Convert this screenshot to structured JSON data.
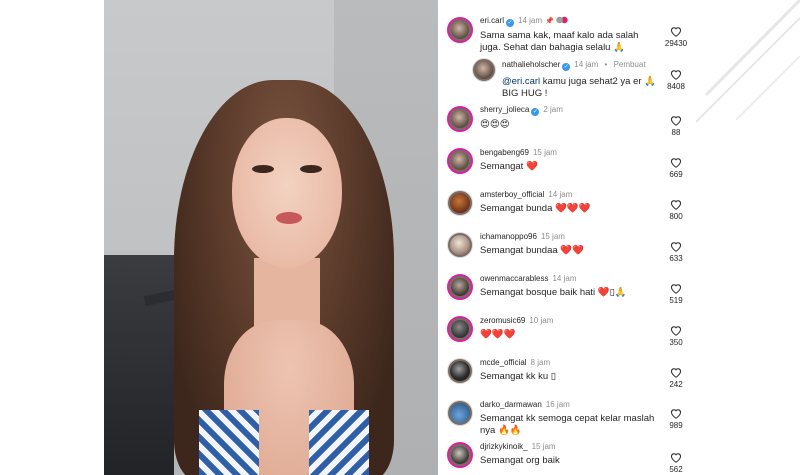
{
  "comments": [
    {
      "username": "eri.carl",
      "time": "14 jam",
      "text": "Sama sama kak, maaf kalo ada salah juga. Sehat dan bahagia selalu 🙏",
      "likes": "29430"
    },
    {
      "username": "nathalieholscher",
      "time": "14 jam",
      "creator_label": "Pembuat",
      "mention": "@eri.carl",
      "text": " kamu juga sehat2 ya er 🙏 BIG HUG !",
      "likes": "8408"
    },
    {
      "username": "sherry_jolieca",
      "time": "2 jam",
      "text": "😍😍😍",
      "likes": "88"
    },
    {
      "username": "bengabeng69",
      "time": "15 jam",
      "text": "Semangat ❤️",
      "likes": "669"
    },
    {
      "username": "amsterboy_official",
      "time": "14 jam",
      "text": "Semangat bunda ❤️❤️❤️",
      "likes": "800"
    },
    {
      "username": "ichamanoppo96",
      "time": "15 jam",
      "text": "Semangat bundaa ❤️❤️",
      "likes": "633"
    },
    {
      "username": "owenmaccarabless",
      "time": "14 jam",
      "text": "Semangat bosque baik hati ❤️▯🙏",
      "likes": "519"
    },
    {
      "username": "zeromusic69",
      "time": "10 jam",
      "text": "❤️❤️❤️",
      "likes": "350"
    },
    {
      "username": "mcde_official",
      "time": "8 jam",
      "text": "Semangat kk ku ▯",
      "likes": "242"
    },
    {
      "username": "darko_darmawan",
      "time": "16 jam",
      "text": "Semangat kk  semoga cepat kelar maslah nya 🔥🔥",
      "likes": "989"
    },
    {
      "username": "djrizkykinoik_",
      "time": "15 jam",
      "text": "Semangat org baik",
      "likes": "562"
    }
  ],
  "colors": {
    "story_ring": "#d6249f",
    "verified": "#3897f0",
    "mention": "#00376b",
    "text": "#262626",
    "muted": "#8e8e8e"
  },
  "icons": {
    "like": "heart-outline-icon",
    "verified": "verified-badge-icon",
    "pinned": "pin-icon"
  }
}
